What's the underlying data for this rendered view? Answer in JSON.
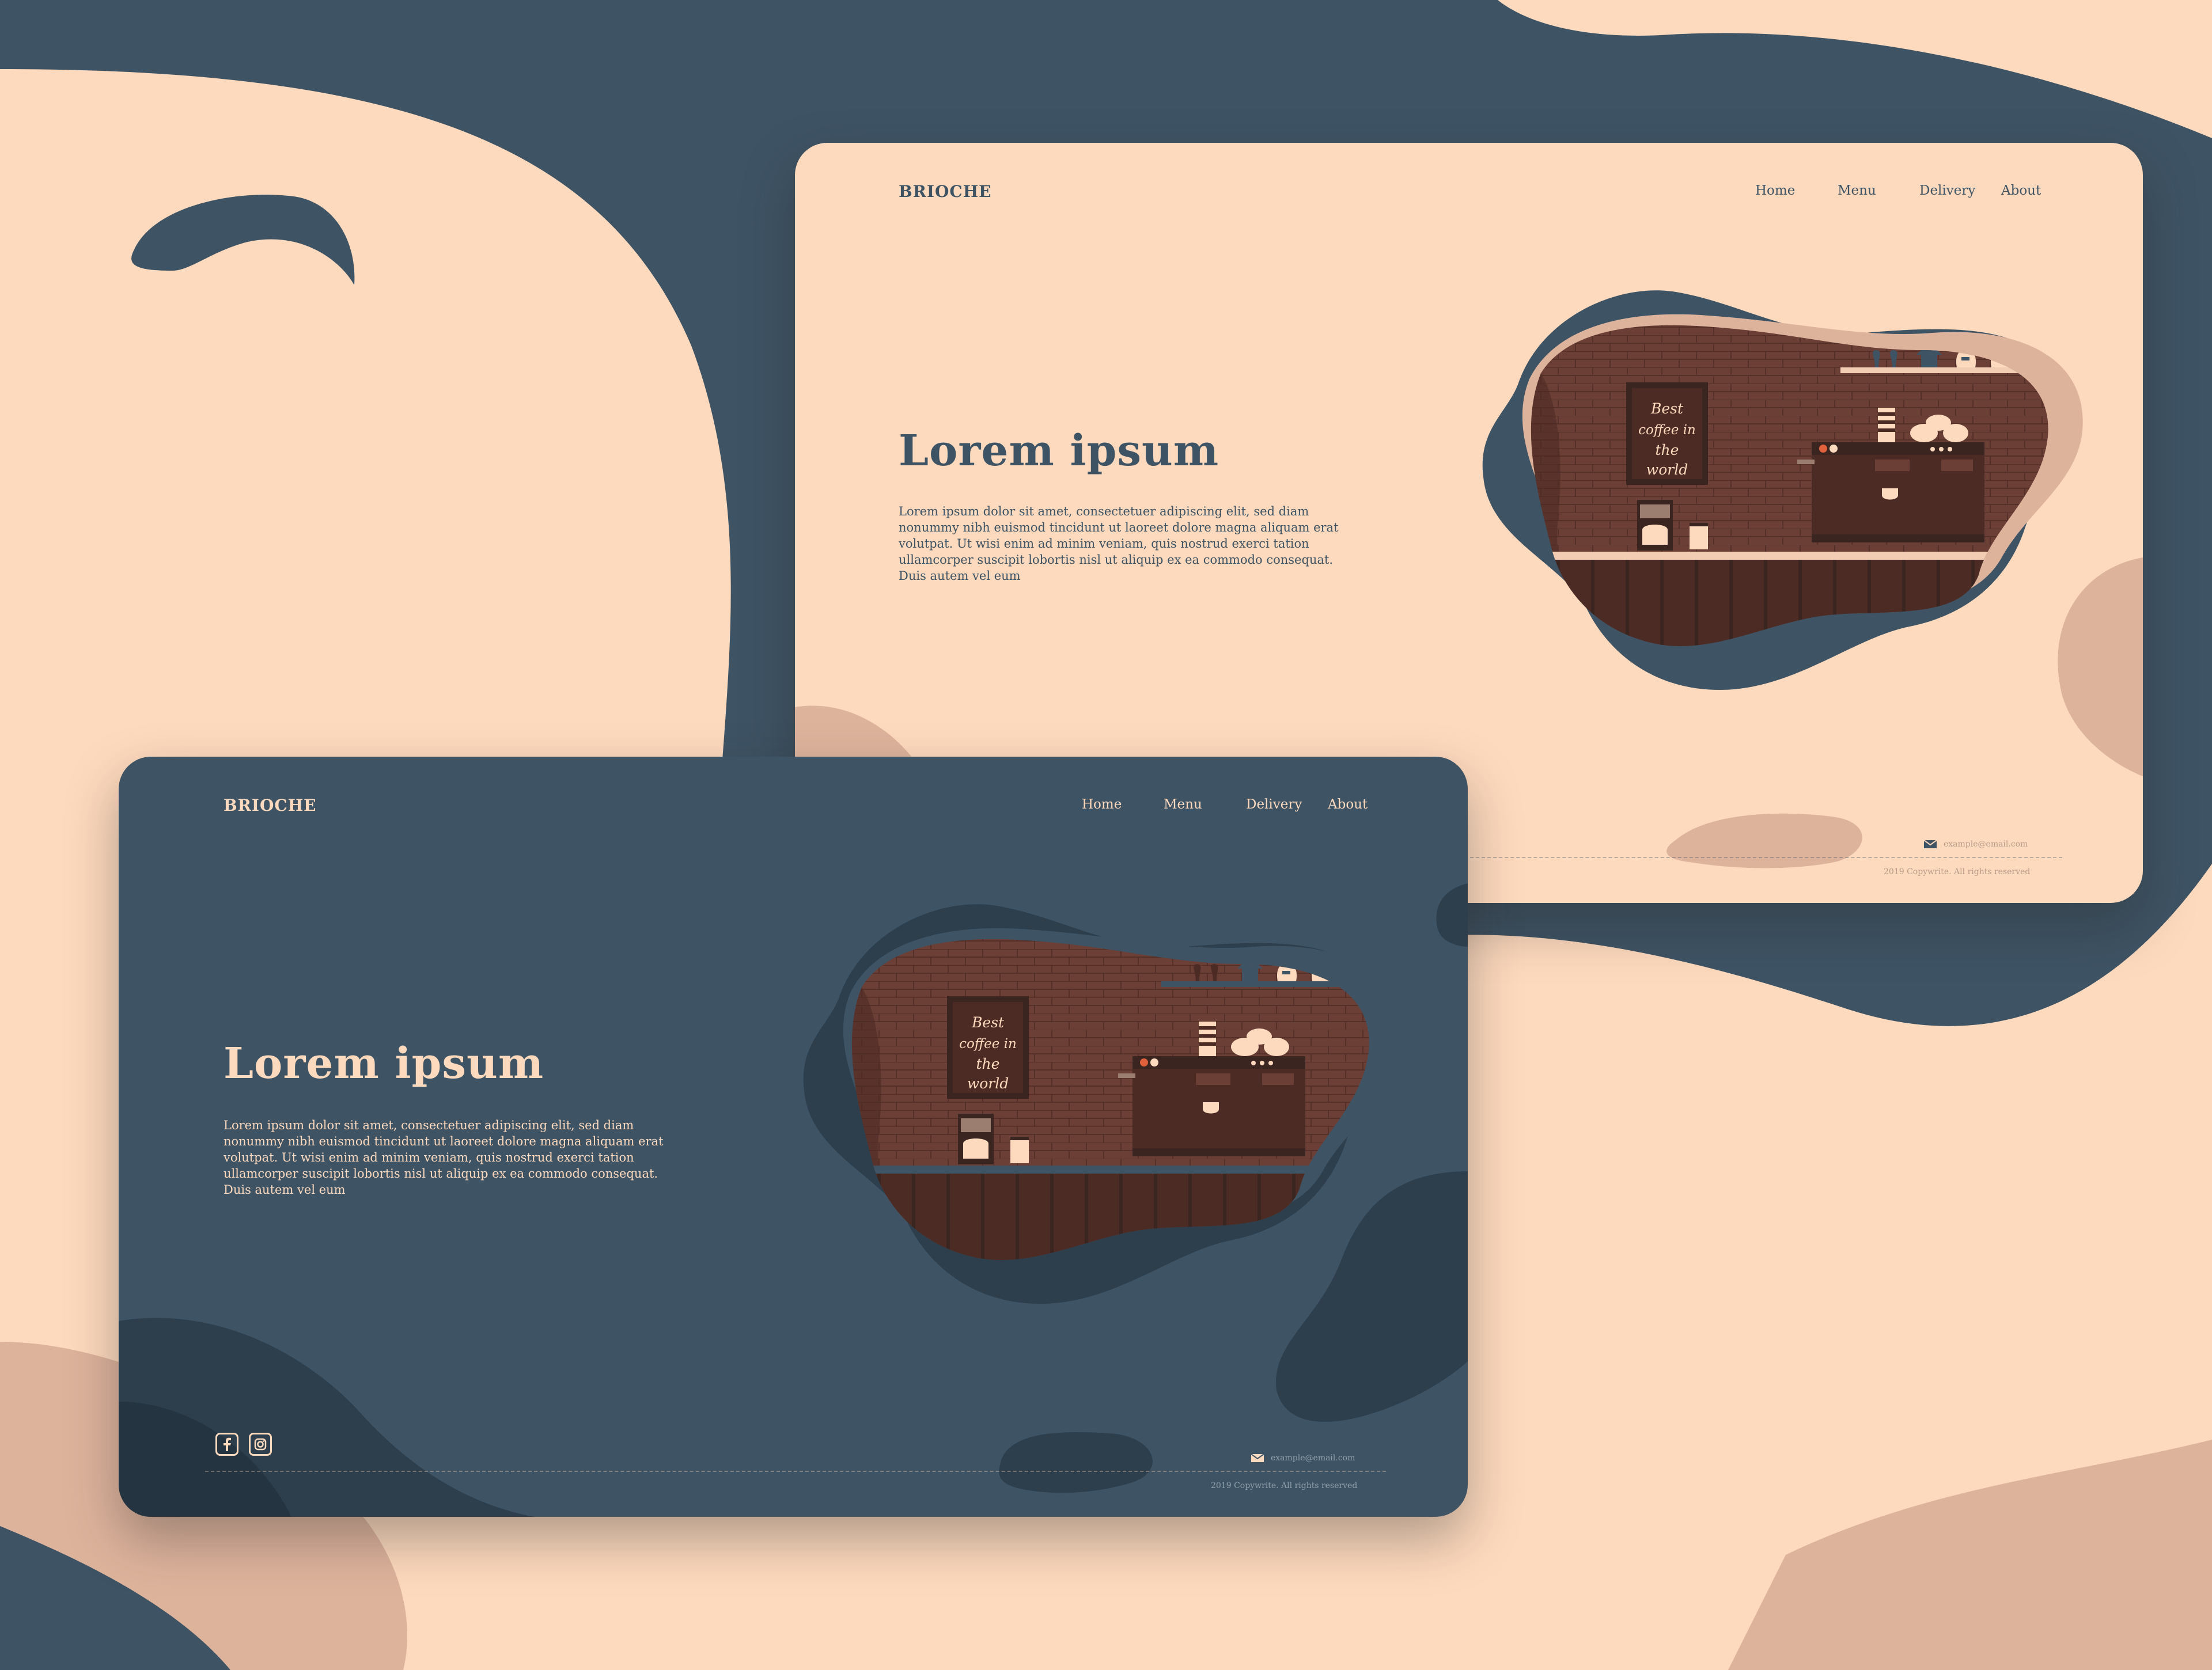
{
  "colors": {
    "peach": "#fdd9bd",
    "slate": "#3e5364",
    "dark_slate": "#2d3e4c",
    "rose": "#deb39c",
    "brick": "#6b3f35"
  },
  "cards": [
    {
      "theme": "light",
      "brand": "BRIOCHE",
      "nav": [
        "Home",
        "Menu",
        "Delivery",
        "About"
      ],
      "hero_title": "Lorem ipsum",
      "hero_body": "Lorem ipsum dolor sit amet, consectetuer adipiscing elit, sed diam nonummy nibh euismod tincidunt ut laoreet dolore magna aliquam erat volutpat. Ut wisi enim ad minim veniam, quis nostrud exerci tation ullamcorper suscipit lobortis nisl ut aliquip ex ea commodo consequat. Duis autem vel eum",
      "poster_lines": [
        "Best",
        "coffee in",
        "the",
        "world"
      ],
      "email": "example@email.com",
      "copyright": "2019 Copywrite. All rights reserved",
      "mail_icon": "envelope-icon"
    },
    {
      "theme": "dark",
      "brand": "BRIOCHE",
      "nav": [
        "Home",
        "Menu",
        "Delivery",
        "About"
      ],
      "hero_title": "Lorem ipsum",
      "hero_body": "Lorem ipsum dolor sit amet, consectetuer adipiscing elit, sed diam nonummy nibh euismod tincidunt ut laoreet dolore magna aliquam erat volutpat. Ut wisi enim ad minim veniam, quis nostrud exerci tation ullamcorper suscipit lobortis nisl ut aliquip ex ea commodo consequat. Duis autem vel eum",
      "poster_lines": [
        "Best",
        "coffee in",
        "the",
        "world"
      ],
      "email": "example@email.com",
      "copyright": "2019 Copywrite. All rights reserved",
      "mail_icon": "envelope-icon",
      "social": [
        "facebook-icon",
        "instagram-icon"
      ]
    }
  ]
}
